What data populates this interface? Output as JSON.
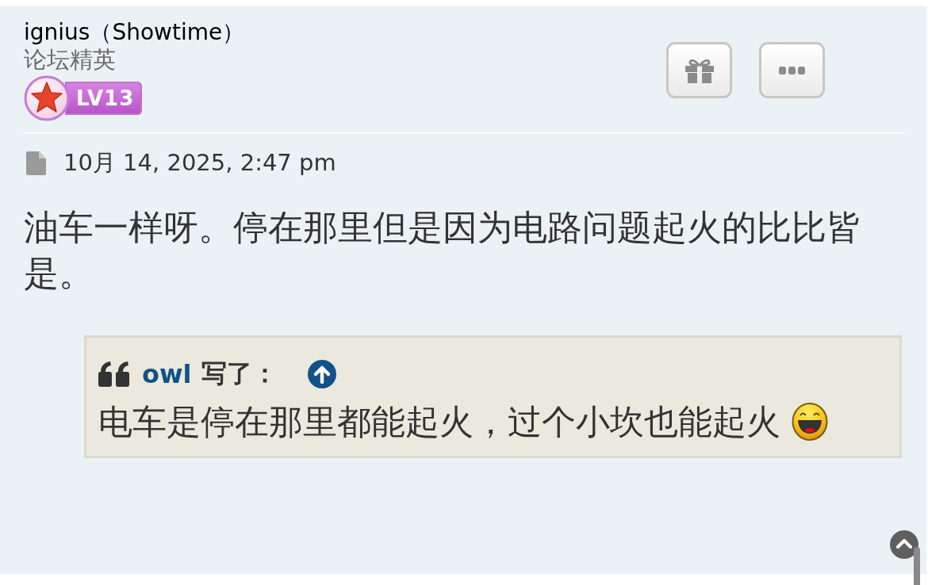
{
  "post": {
    "author": {
      "name": "ignius（Showtime）",
      "rank": "论坛精英",
      "level_badge": "LV13"
    },
    "date": "10月 14, 2025, 2:47 pm",
    "content": "油车一样呀。停在那里但是因为电路问题起火的比比皆是。",
    "quote": {
      "author": "owl",
      "wrote": "写了：",
      "text": "电车是停在那里都能起火，过个小坎也能起火"
    }
  }
}
